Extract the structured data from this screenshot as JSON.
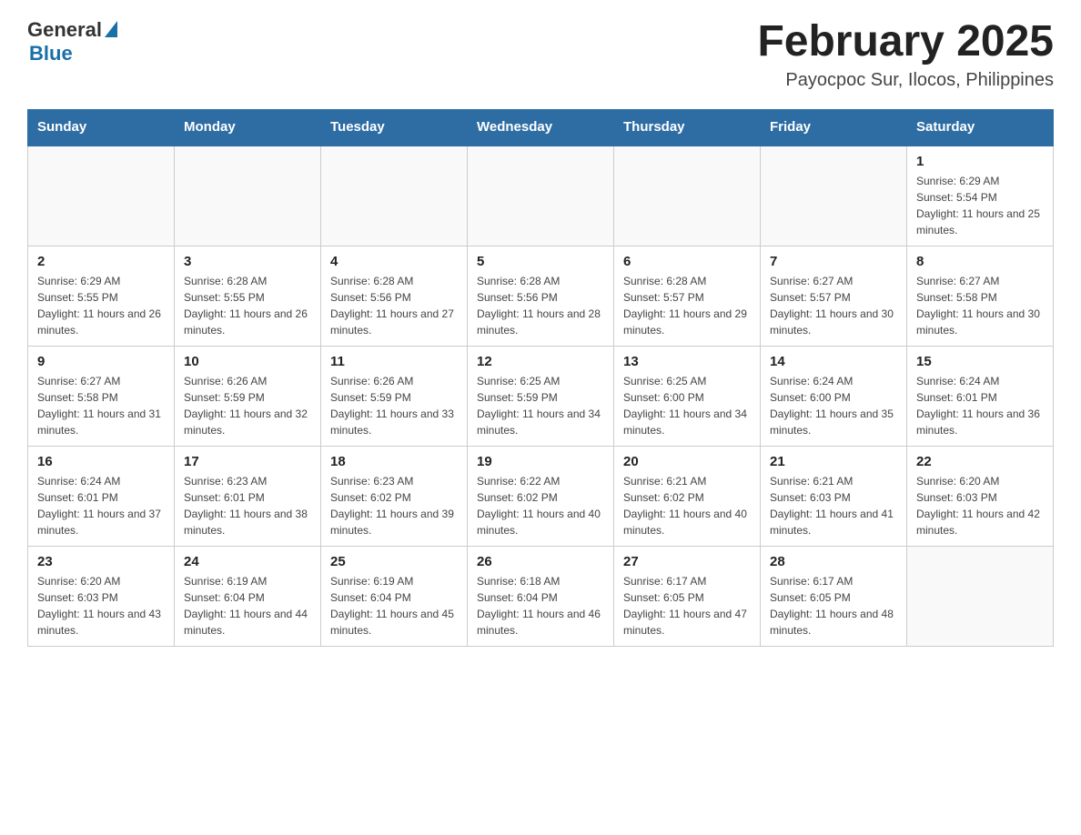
{
  "header": {
    "logo_general": "General",
    "logo_blue": "Blue",
    "month_title": "February 2025",
    "location": "Payocpoc Sur, Ilocos, Philippines"
  },
  "weekdays": [
    "Sunday",
    "Monday",
    "Tuesday",
    "Wednesday",
    "Thursday",
    "Friday",
    "Saturday"
  ],
  "weeks": [
    [
      {
        "day": "",
        "info": ""
      },
      {
        "day": "",
        "info": ""
      },
      {
        "day": "",
        "info": ""
      },
      {
        "day": "",
        "info": ""
      },
      {
        "day": "",
        "info": ""
      },
      {
        "day": "",
        "info": ""
      },
      {
        "day": "1",
        "info": "Sunrise: 6:29 AM\nSunset: 5:54 PM\nDaylight: 11 hours and 25 minutes."
      }
    ],
    [
      {
        "day": "2",
        "info": "Sunrise: 6:29 AM\nSunset: 5:55 PM\nDaylight: 11 hours and 26 minutes."
      },
      {
        "day": "3",
        "info": "Sunrise: 6:28 AM\nSunset: 5:55 PM\nDaylight: 11 hours and 26 minutes."
      },
      {
        "day": "4",
        "info": "Sunrise: 6:28 AM\nSunset: 5:56 PM\nDaylight: 11 hours and 27 minutes."
      },
      {
        "day": "5",
        "info": "Sunrise: 6:28 AM\nSunset: 5:56 PM\nDaylight: 11 hours and 28 minutes."
      },
      {
        "day": "6",
        "info": "Sunrise: 6:28 AM\nSunset: 5:57 PM\nDaylight: 11 hours and 29 minutes."
      },
      {
        "day": "7",
        "info": "Sunrise: 6:27 AM\nSunset: 5:57 PM\nDaylight: 11 hours and 30 minutes."
      },
      {
        "day": "8",
        "info": "Sunrise: 6:27 AM\nSunset: 5:58 PM\nDaylight: 11 hours and 30 minutes."
      }
    ],
    [
      {
        "day": "9",
        "info": "Sunrise: 6:27 AM\nSunset: 5:58 PM\nDaylight: 11 hours and 31 minutes."
      },
      {
        "day": "10",
        "info": "Sunrise: 6:26 AM\nSunset: 5:59 PM\nDaylight: 11 hours and 32 minutes."
      },
      {
        "day": "11",
        "info": "Sunrise: 6:26 AM\nSunset: 5:59 PM\nDaylight: 11 hours and 33 minutes."
      },
      {
        "day": "12",
        "info": "Sunrise: 6:25 AM\nSunset: 5:59 PM\nDaylight: 11 hours and 34 minutes."
      },
      {
        "day": "13",
        "info": "Sunrise: 6:25 AM\nSunset: 6:00 PM\nDaylight: 11 hours and 34 minutes."
      },
      {
        "day": "14",
        "info": "Sunrise: 6:24 AM\nSunset: 6:00 PM\nDaylight: 11 hours and 35 minutes."
      },
      {
        "day": "15",
        "info": "Sunrise: 6:24 AM\nSunset: 6:01 PM\nDaylight: 11 hours and 36 minutes."
      }
    ],
    [
      {
        "day": "16",
        "info": "Sunrise: 6:24 AM\nSunset: 6:01 PM\nDaylight: 11 hours and 37 minutes."
      },
      {
        "day": "17",
        "info": "Sunrise: 6:23 AM\nSunset: 6:01 PM\nDaylight: 11 hours and 38 minutes."
      },
      {
        "day": "18",
        "info": "Sunrise: 6:23 AM\nSunset: 6:02 PM\nDaylight: 11 hours and 39 minutes."
      },
      {
        "day": "19",
        "info": "Sunrise: 6:22 AM\nSunset: 6:02 PM\nDaylight: 11 hours and 40 minutes."
      },
      {
        "day": "20",
        "info": "Sunrise: 6:21 AM\nSunset: 6:02 PM\nDaylight: 11 hours and 40 minutes."
      },
      {
        "day": "21",
        "info": "Sunrise: 6:21 AM\nSunset: 6:03 PM\nDaylight: 11 hours and 41 minutes."
      },
      {
        "day": "22",
        "info": "Sunrise: 6:20 AM\nSunset: 6:03 PM\nDaylight: 11 hours and 42 minutes."
      }
    ],
    [
      {
        "day": "23",
        "info": "Sunrise: 6:20 AM\nSunset: 6:03 PM\nDaylight: 11 hours and 43 minutes."
      },
      {
        "day": "24",
        "info": "Sunrise: 6:19 AM\nSunset: 6:04 PM\nDaylight: 11 hours and 44 minutes."
      },
      {
        "day": "25",
        "info": "Sunrise: 6:19 AM\nSunset: 6:04 PM\nDaylight: 11 hours and 45 minutes."
      },
      {
        "day": "26",
        "info": "Sunrise: 6:18 AM\nSunset: 6:04 PM\nDaylight: 11 hours and 46 minutes."
      },
      {
        "day": "27",
        "info": "Sunrise: 6:17 AM\nSunset: 6:05 PM\nDaylight: 11 hours and 47 minutes."
      },
      {
        "day": "28",
        "info": "Sunrise: 6:17 AM\nSunset: 6:05 PM\nDaylight: 11 hours and 48 minutes."
      },
      {
        "day": "",
        "info": ""
      }
    ]
  ]
}
